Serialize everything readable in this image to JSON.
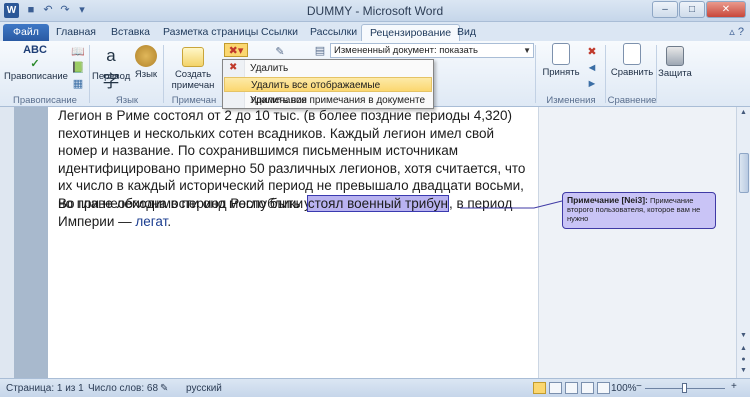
{
  "window": {
    "title": "DUMMY - Microsoft Word",
    "app_letter": "W"
  },
  "tabs": [
    "Файл",
    "Главная",
    "Вставка",
    "Разметка страницы",
    "Ссылки",
    "Рассылки",
    "Рецензирование",
    "Вид"
  ],
  "ribbon": {
    "spelling": "Правописание",
    "translate": "Перевод",
    "language": "Язык",
    "new_comment": "Создать примечание",
    "new_comment_l1": "Создать",
    "new_comment_l2": "примечан",
    "display_combo": "Измененный документ: показать исправления",
    "accept": "Принять",
    "compare": "Сравнить",
    "protect": "Защита",
    "groups": {
      "proofing": "Правописание",
      "language": "Язык",
      "comments": "Примечан",
      "changes": "Изменения",
      "compare": "Сравнение"
    }
  },
  "delete_menu": {
    "items": [
      "Удалить",
      "Удалить все отображаемые примечания",
      "Удалить все примечания в документе"
    ],
    "highlighted_index": 1
  },
  "document": {
    "para1": "Легион в Риме состоял от 2 до 10 тыс. (в более поздние периоды 4,320) пехотинцев и нескольких сотен всадников. Каждый легион имел свой номер и название. По сохранившимся письменным источникам идентифицировано примерно 50 различных легионов, хотя считается, что их число в каждый исторический период не превышало двадцати восьми, но при необходимости оно могло быть увеличено.",
    "para2_before": "Во главе легиона в период Республики ",
    "para2_highlight": "стоял военный трибун",
    "para2_after": ", в период Империи — ",
    "para2_link": "легат",
    "para2_end": "."
  },
  "comment": {
    "title": "Примечание [Nei3]:",
    "text": "Примечание второго пользователя, которое вам не нужно"
  },
  "status": {
    "page": "Страница: 1 из 1",
    "words": "Число слов: 68",
    "language": "русский",
    "zoom": "100%",
    "zoom_level_percent": 100
  }
}
